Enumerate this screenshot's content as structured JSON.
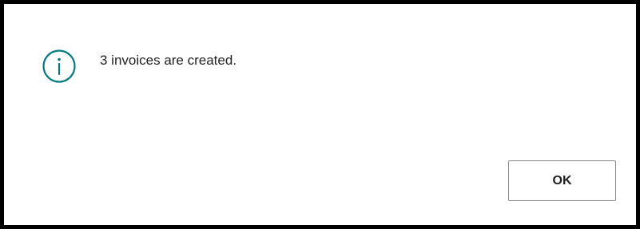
{
  "dialog": {
    "icon": "info-icon",
    "message": "3 invoices are created.",
    "ok_label": "OK"
  },
  "colors": {
    "icon": "#007a86",
    "border": "#000000",
    "button_border": "#8a8a8a"
  }
}
